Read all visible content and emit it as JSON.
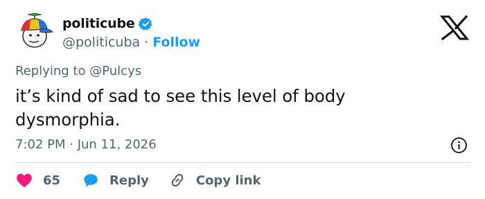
{
  "author": {
    "name": "politicube",
    "handle": "@politicuba",
    "separator": "·",
    "follow_label": "Follow"
  },
  "reply_context": {
    "prefix": "Replying to",
    "mention": "@Pulcys"
  },
  "tweet": {
    "text": "it’s kind of sad to see this level of body dysmorphia.",
    "timestamp": "7:02 PM · Jun 11, 2026"
  },
  "actions": {
    "like_count": "65",
    "reply_label": "Reply",
    "copy_label": "Copy link"
  },
  "colors": {
    "accent": "#1d9bf0",
    "like": "#f91880",
    "text_primary": "#0f1419",
    "text_secondary": "#536471",
    "divider": "#cfd9de"
  },
  "icons": [
    "avatar",
    "verified-badge-icon",
    "x-logo-icon",
    "info-icon",
    "heart-icon",
    "reply-bubble-icon",
    "link-icon"
  ]
}
